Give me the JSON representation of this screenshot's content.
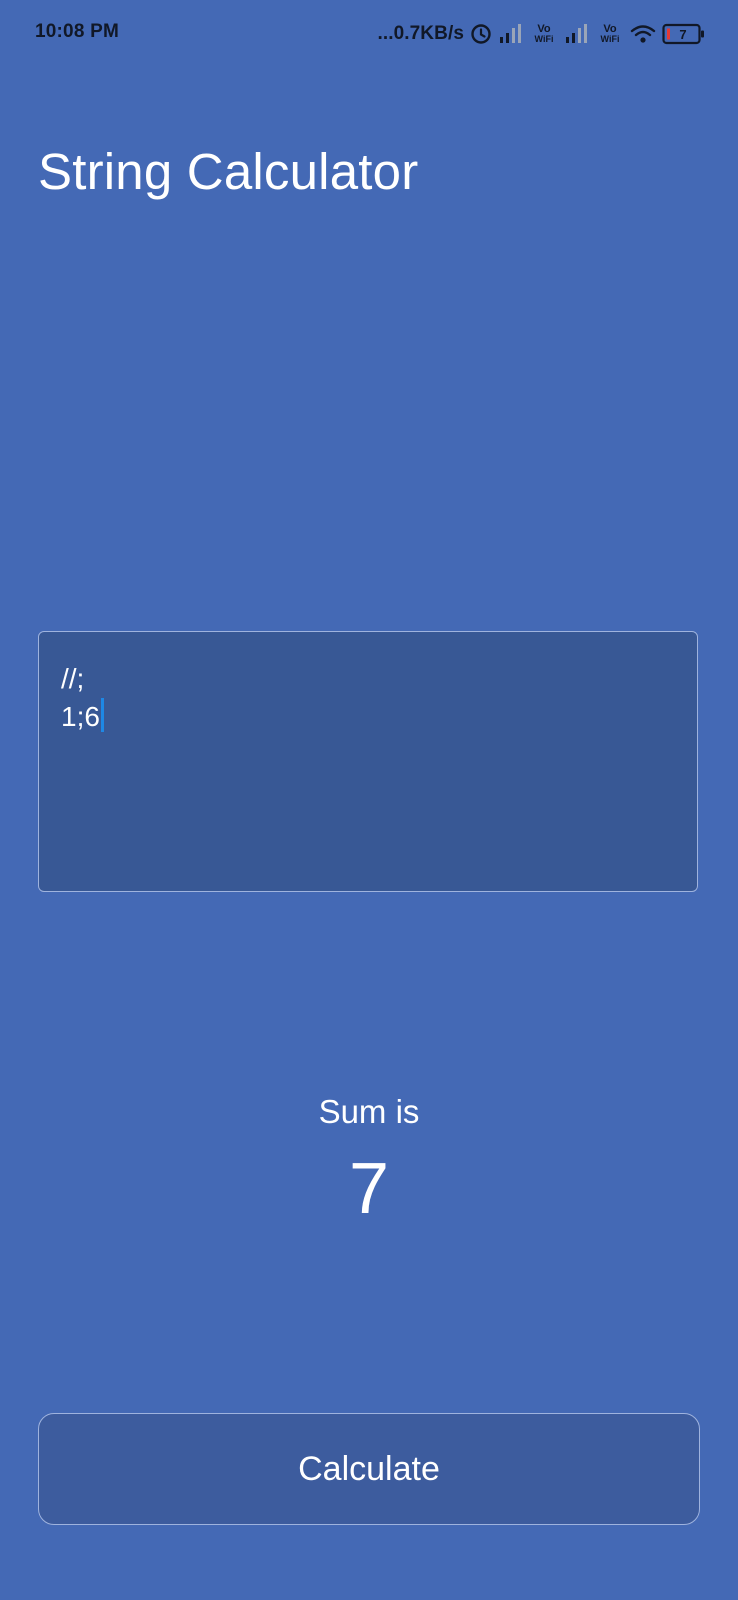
{
  "status_bar": {
    "time": "10:08 PM",
    "net_speed": "...0.7KB/s",
    "vowifi_1": {
      "top": "Vo",
      "bottom": "WiFi"
    },
    "vowifi_2": {
      "top": "Vo",
      "bottom": "WiFi"
    },
    "battery_level": "7"
  },
  "app": {
    "title": "String Calculator"
  },
  "input": {
    "line1": "//;",
    "line2": "1;6"
  },
  "result": {
    "label": "Sum is",
    "value": "7"
  },
  "actions": {
    "calculate_label": "Calculate"
  },
  "colors": {
    "background": "#4469B5",
    "input_background": "#385895",
    "button_background": "#3D5C9E",
    "border": "#9FB3DE",
    "caret": "#1E88E5"
  }
}
